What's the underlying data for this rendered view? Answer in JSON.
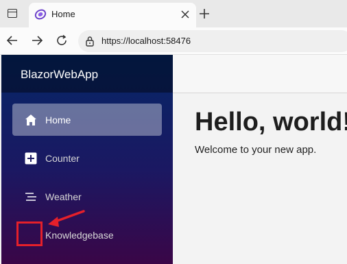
{
  "browser": {
    "tab_title": "Home",
    "url": "https://localhost:58476"
  },
  "app": {
    "brand": "BlazorWebApp",
    "nav": [
      {
        "label": "Home",
        "icon": "house-icon",
        "active": true
      },
      {
        "label": "Counter",
        "icon": "plus-square-icon",
        "active": false
      },
      {
        "label": "Weather",
        "icon": "list-lines-icon",
        "active": false
      },
      {
        "label": "Knowledgebase",
        "icon": "",
        "active": false
      }
    ]
  },
  "page": {
    "heading": "Hello, world!",
    "text": "Welcome to your new app."
  },
  "colors": {
    "annotation": "#e5202a",
    "sidebar_top": "#052767",
    "sidebar_bottom": "#3a0647"
  }
}
